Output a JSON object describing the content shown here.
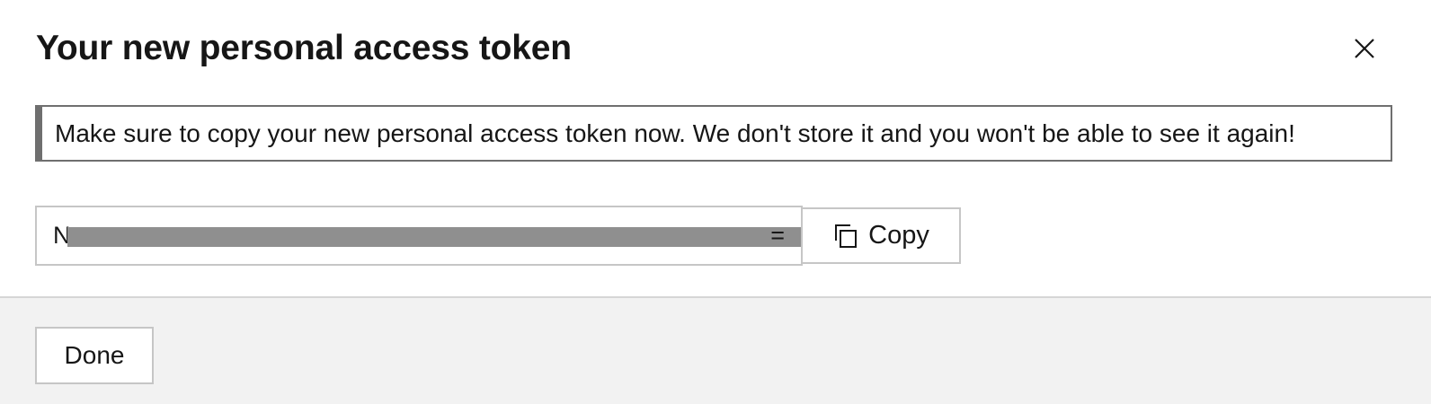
{
  "dialog": {
    "title": "Your new personal access token",
    "close_icon": "close-icon"
  },
  "notice": {
    "text": "Make sure to copy your new personal access token now. We don't store it and you won't be able to see it again!"
  },
  "token": {
    "prefix": "N",
    "suffix": "=",
    "redacted": true
  },
  "copy_button": {
    "label": "Copy",
    "icon": "copy-icon"
  },
  "footer": {
    "done_label": "Done"
  },
  "colors": {
    "text": "#161616",
    "notice_border": "#6f6f6f",
    "field_border": "#c6c6c6",
    "footer_bg": "#f2f2f2",
    "redaction": "#8f8f8f"
  }
}
